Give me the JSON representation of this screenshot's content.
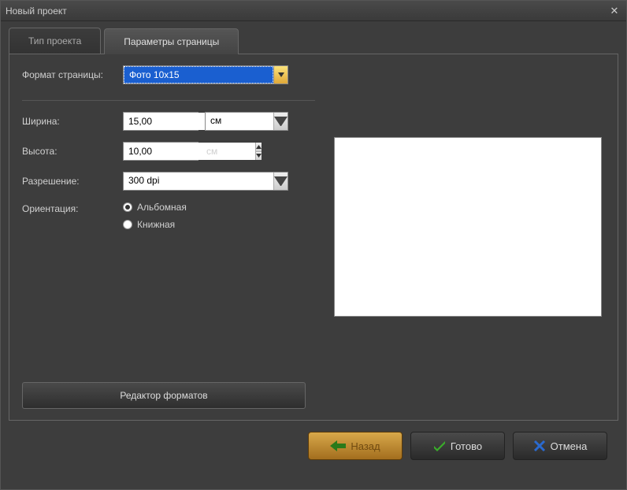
{
  "window": {
    "title": "Новый проект"
  },
  "tabs": {
    "project_type": "Тип проекта",
    "page_params": "Параметры страницы"
  },
  "form": {
    "format_label": "Формат страницы:",
    "format_value": "Фото 10х15",
    "width_label": "Ширина:",
    "width_value": "15,00",
    "width_unit": "см",
    "height_label": "Высота:",
    "height_value": "10,00",
    "height_unit": "см",
    "resolution_label": "Разрешение:",
    "resolution_value": "300 dpi",
    "orientation_label": "Ориентация:",
    "orientation_landscape": "Альбомная",
    "orientation_portrait": "Книжная",
    "format_editor": "Редактор форматов"
  },
  "buttons": {
    "back": "Назад",
    "done": "Готово",
    "cancel": "Отмена"
  }
}
